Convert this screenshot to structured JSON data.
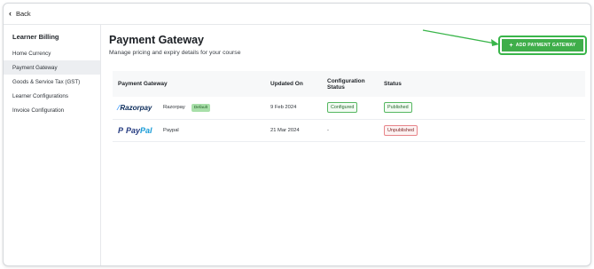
{
  "topbar": {
    "back_label": "Back"
  },
  "sidebar": {
    "heading": "Learner Billing",
    "items": [
      {
        "label": "Home Currency"
      },
      {
        "label": "Payment Gateway"
      },
      {
        "label": "Goods & Service Tax (GST)"
      },
      {
        "label": "Learner Configurations"
      },
      {
        "label": "Invoice Configuration"
      }
    ]
  },
  "main": {
    "title": "Payment Gateway",
    "subtitle": "Manage pricing and expiry details for your course",
    "add_button_label": "ADD PAYMENT GATEWAY"
  },
  "table": {
    "headers": {
      "gateway": "Payment Gateway",
      "updated": "Updated On",
      "config": "Configuration Status",
      "status": "Status"
    },
    "rows": [
      {
        "logo": {
          "mark": "⁄",
          "text": "Razorpay"
        },
        "name": "Razorpay",
        "default_badge": "Default",
        "updated": "9 Feb 2024",
        "config": "Configured",
        "status": "Published"
      },
      {
        "logo": {
          "icon": "P",
          "text1": "Pay",
          "text2": "Pal"
        },
        "name": "Paypal",
        "updated": "21 Mar 2024",
        "config": "-",
        "status": "Unpublished"
      }
    ]
  },
  "colors": {
    "accent_green": "#3fae4a",
    "annotation_arrow": "#39b54a",
    "published_border": "#56b761",
    "unpublished_border": "#e8858a"
  }
}
